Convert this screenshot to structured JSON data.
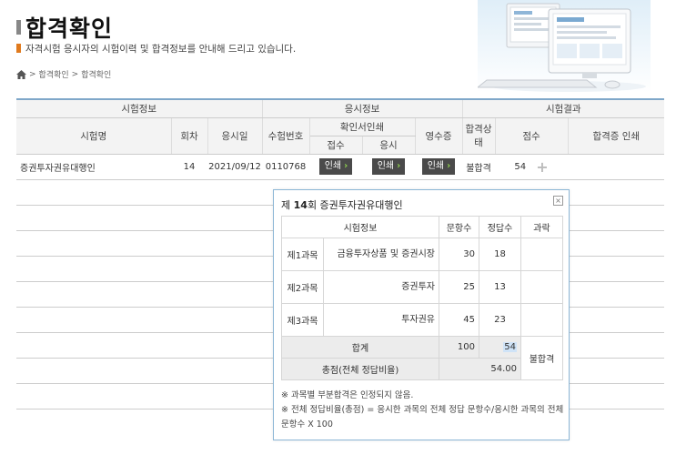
{
  "header": {
    "title": "합격확인",
    "subtitle": "자격시험 응시자의 시험이력 및 합격정보를 안내해 드리고 있습니다.",
    "breadcrumb": [
      "합격확인",
      "합격확인"
    ]
  },
  "table": {
    "groups": {
      "exam_info": "시험정보",
      "apply_info": "응시정보",
      "result": "시험결과"
    },
    "cols": {
      "exam_name": "시험명",
      "round": "회차",
      "exam_date": "응시일",
      "exam_no": "수험번호",
      "confirm_print": "확인서인쇄",
      "receipt": "접수",
      "apply": "응시",
      "payment": "영수증",
      "pass_status": "합격상태",
      "score": "점수",
      "cert_print": "합격증 인쇄"
    },
    "rows": [
      {
        "exam_name": "증권투자권유대행인",
        "round": "14",
        "exam_date": "2021/09/12",
        "exam_no": "0110768",
        "print_label": "인쇄",
        "status": "불합격",
        "score": "54"
      }
    ]
  },
  "popup": {
    "title_prefix": "제 ",
    "round_bold": "14",
    "title_suffix": "회 증권투자권유대행인",
    "close": "×",
    "cols": {
      "subject": "시험정보",
      "questions": "문항수",
      "correct": "정답수",
      "fail": "과락"
    },
    "subjects": [
      {
        "code": "제1과목",
        "name": "금융투자상품 및 증권시장",
        "questions": "30",
        "correct": "18"
      },
      {
        "code": "제2과목",
        "name": "증권투자",
        "questions": "25",
        "correct": "13"
      },
      {
        "code": "제3과목",
        "name": "투자권유",
        "questions": "45",
        "correct": "23"
      }
    ],
    "total_label": "합계",
    "total_questions": "100",
    "total_correct": "54",
    "overall_label": "총점(전체 정답비율)",
    "overall_value": "54.00",
    "result_label": "불합격",
    "notes": [
      "※ 과목별 부분합격은 인정되지 않음.",
      "※ 전체 정답비율(총점) = 응시한 과목의 전체 정답 문항수/응시한 과목의 전체 문항수 X 100"
    ]
  }
}
